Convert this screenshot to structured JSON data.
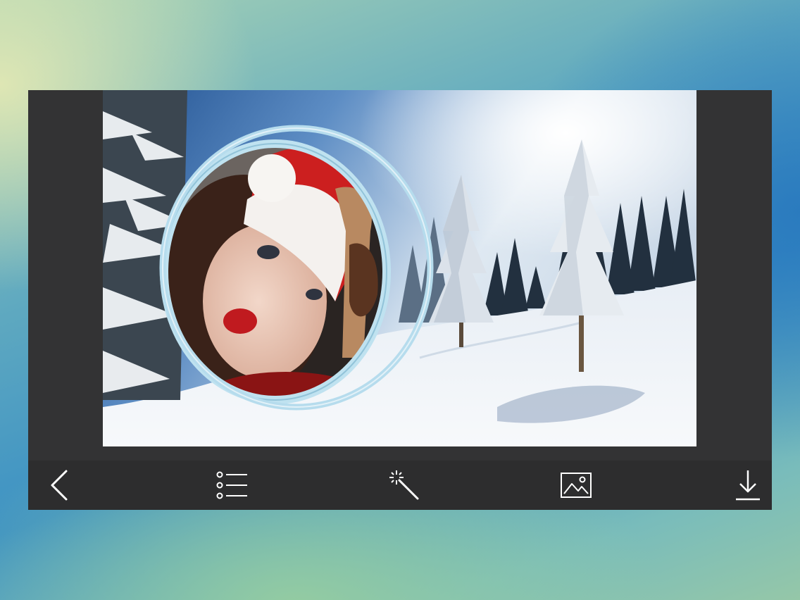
{
  "editor": {
    "background_scene": "snowy-forest-landscape",
    "frame_style": "double-oval-ring",
    "photo_subject": "woman-in-santa-hat"
  },
  "toolbar": {
    "buttons": [
      {
        "id": "back",
        "icon": "chevron-left-icon"
      },
      {
        "id": "frames-list",
        "icon": "list-icon"
      },
      {
        "id": "effects",
        "icon": "magic-wand-icon"
      },
      {
        "id": "gallery",
        "icon": "image-icon"
      },
      {
        "id": "save",
        "icon": "download-icon"
      }
    ]
  },
  "colors": {
    "panel": "#333334",
    "toolbar": "#2d2d2e",
    "icon": "#ffffff",
    "frame_ring": "#a9d4e6"
  }
}
